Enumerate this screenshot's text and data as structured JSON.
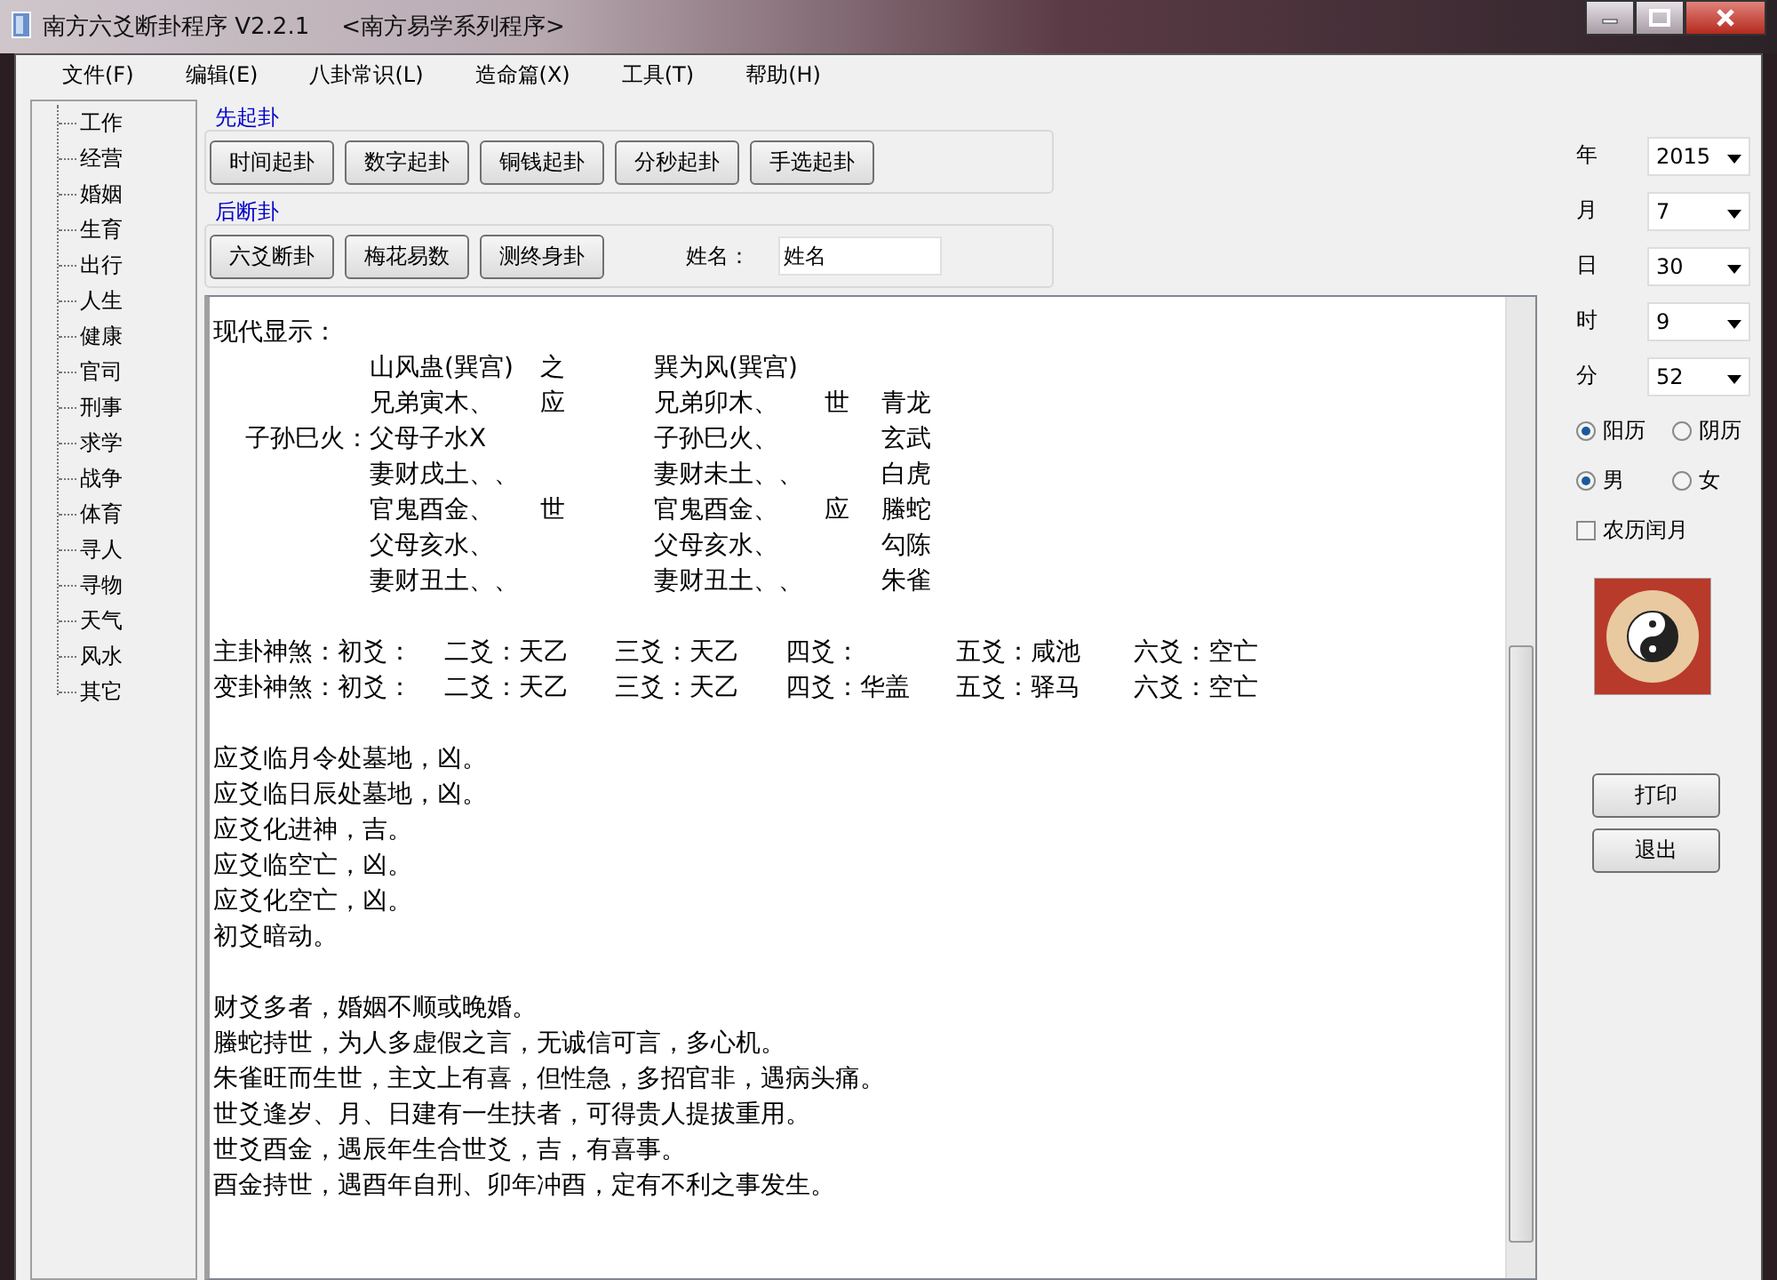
{
  "window": {
    "title": "南方六爻断卦程序 V2.2.1",
    "subtitle": "<南方易学系列程序>"
  },
  "menu": [
    "文件(F)",
    "编辑(E)",
    "八卦常识(L)",
    "造命篇(X)",
    "工具(T)",
    "帮助(H)"
  ],
  "tree": {
    "items": [
      "工作",
      "经营",
      "婚姻",
      "生育",
      "出行",
      "人生",
      "健康",
      "官司",
      "刑事",
      "求学",
      "战争",
      "体育",
      "寻人",
      "寻物",
      "天气",
      "风水",
      "其它"
    ]
  },
  "cast_group": {
    "title": "先起卦",
    "buttons": [
      "时间起卦",
      "数字起卦",
      "铜钱起卦",
      "分秒起卦",
      "手选起卦"
    ]
  },
  "judge_group": {
    "title": "后断卦",
    "buttons": [
      "六爻断卦",
      "梅花易数",
      "测终身卦"
    ],
    "name_label": "姓名：",
    "name_field": {
      "value": "姓名"
    }
  },
  "output": {
    "heading": "现代显示：",
    "hexagram": {
      "left_name": "山风蛊(巽宫)",
      "joiner": "之",
      "right_name": "巽为风(巽宫)",
      "rows": [
        {
          "hidden": "",
          "left": "兄弟寅木、",
          "left_mark": "应",
          "right": "兄弟卯木、",
          "right_mark": "世",
          "spirit": "青龙"
        },
        {
          "hidden": "子孙巳火：",
          "left": "父母子水X",
          "left_mark": "",
          "right": "子孙巳火、",
          "right_mark": "",
          "spirit": "玄武"
        },
        {
          "hidden": "",
          "left": "妻财戌土、、",
          "left_mark": "",
          "right": "妻财未土、、",
          "right_mark": "",
          "spirit": "白虎"
        },
        {
          "hidden": "",
          "left": "官鬼酉金、",
          "left_mark": "世",
          "right": "官鬼酉金、",
          "right_mark": "应",
          "spirit": "螣蛇"
        },
        {
          "hidden": "",
          "left": "父母亥水、",
          "left_mark": "",
          "right": "父母亥水、",
          "right_mark": "",
          "spirit": "勾陈"
        },
        {
          "hidden": "",
          "left": "妻财丑土、、",
          "left_mark": "",
          "right": "妻财丑土、、",
          "right_mark": "",
          "spirit": "朱雀"
        }
      ]
    },
    "shensha": [
      {
        "label": "主卦神煞：",
        "items": [
          "初爻：",
          "二爻：天乙",
          "三爻：天乙",
          "四爻：",
          "五爻：咸池",
          "六爻：空亡"
        ]
      },
      {
        "label": "变卦神煞：",
        "items": [
          "初爻：",
          "二爻：天乙",
          "三爻：天乙",
          "四爻：华盖",
          "五爻：驿马",
          "六爻：空亡"
        ]
      }
    ],
    "paragraphs": [
      [
        "应爻临月令处墓地，凶。",
        "应爻临日辰处墓地，凶。",
        "应爻化进神，吉。",
        "应爻临空亡，凶。",
        "应爻化空亡，凶。",
        "初爻暗动。"
      ],
      [
        "财爻多者，婚姻不顺或晚婚。",
        "螣蛇持世，为人多虚假之言，无诚信可言，多心机。",
        "朱雀旺而生世，主文上有喜，但性急，多招官非，遇病头痛。",
        "世爻逢岁、月、日建有一生扶者，可得贵人提拔重用。",
        "世爻酉金，遇辰年生合世爻，吉，有喜事。",
        "酉金持世，遇酉年自刑、卯年冲酉，定有不利之事发生。"
      ]
    ]
  },
  "date_fields": [
    {
      "label": "年",
      "value": "2015"
    },
    {
      "label": "月",
      "value": "7"
    },
    {
      "label": "日",
      "value": "30"
    },
    {
      "label": "时",
      "value": "9"
    },
    {
      "label": "分",
      "value": "52"
    }
  ],
  "calendar_radios": [
    {
      "label": "阳历",
      "selected": true
    },
    {
      "label": "阴历",
      "selected": false
    }
  ],
  "gender_radios": [
    {
      "label": "男",
      "selected": true
    },
    {
      "label": "女",
      "selected": false
    }
  ],
  "leap_month": {
    "label": "农历闰月",
    "checked": false
  },
  "actions": [
    "打印",
    "退出"
  ]
}
